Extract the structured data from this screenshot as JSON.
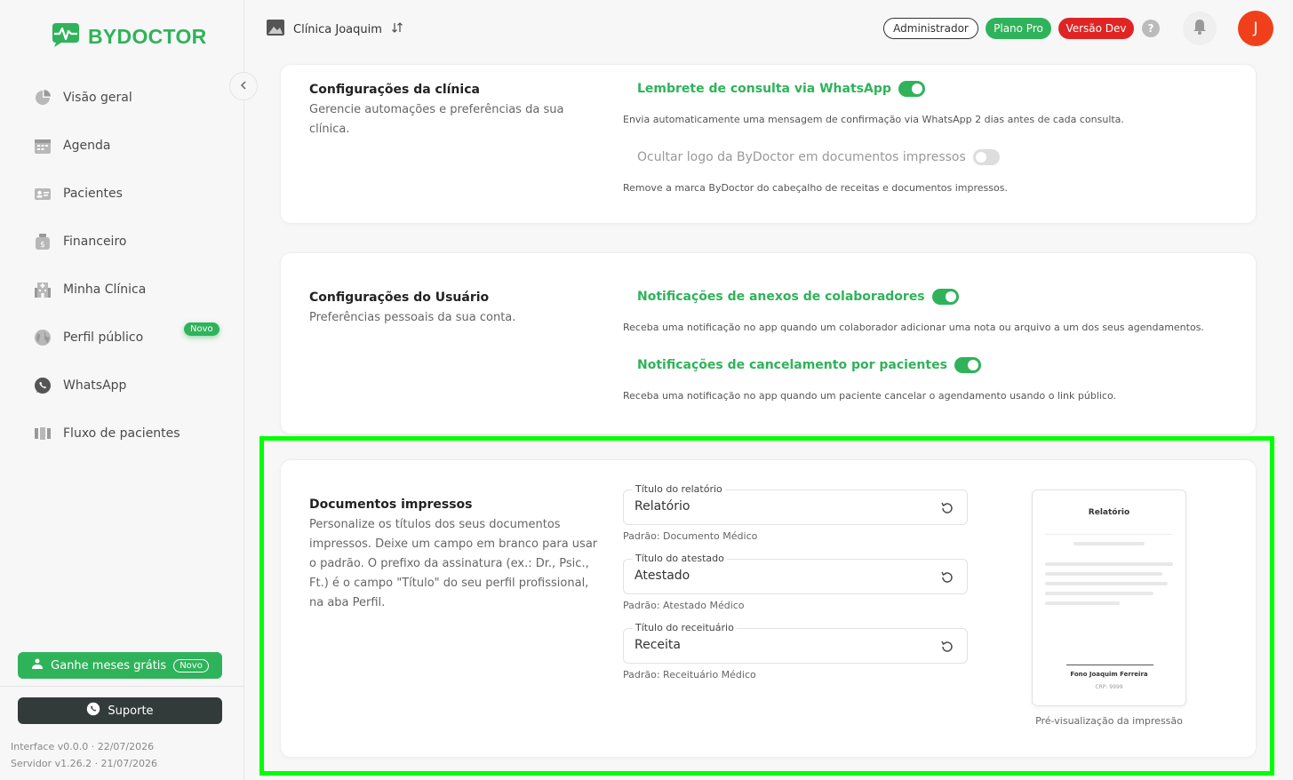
{
  "brand": {
    "name": "BYDOCTOR",
    "accent": "#2fb35a"
  },
  "sidebar": {
    "items": [
      {
        "label": "Visão geral",
        "icon": "pie-chart-icon"
      },
      {
        "label": "Agenda",
        "icon": "calendar-icon"
      },
      {
        "label": "Pacientes",
        "icon": "patient-card-icon"
      },
      {
        "label": "Financeiro",
        "icon": "money-bag-icon"
      },
      {
        "label": "Minha Clínica",
        "icon": "building-icon"
      },
      {
        "label": "Perfil público",
        "icon": "globe-icon",
        "badge": "Novo"
      },
      {
        "label": "WhatsApp",
        "icon": "whatsapp-icon"
      },
      {
        "label": "Fluxo de pacientes",
        "icon": "kanban-icon"
      }
    ],
    "promo": {
      "label": "Ganhe meses grátis",
      "badge": "Novo"
    },
    "support": {
      "label": "Suporte"
    },
    "version_interface": "Interface v0.0.0 · 22/07/2026",
    "version_server": "Servidor v1.26.2 · 21/07/2026"
  },
  "topbar": {
    "clinic": "Clínica Joaquim",
    "role": "Administrador",
    "plan": "Plano Pro",
    "version": "Versão Dev",
    "help": "?",
    "avatar_initial": "J"
  },
  "clinic_settings": {
    "title": "Configurações da clínica",
    "desc": "Gerencie automações e preferências da sua clínica.",
    "whatsapp_reminder": {
      "label": "Lembrete de consulta via WhatsApp",
      "enabled": true,
      "desc": "Envia automaticamente uma mensagem de confirmação via WhatsApp 2 dias antes de cada consulta."
    },
    "hide_logo": {
      "label": "Ocultar logo da ByDoctor em documentos impressos",
      "enabled": false,
      "desc": "Remove a marca ByDoctor do cabeçalho de receitas e documentos impressos."
    }
  },
  "user_settings": {
    "title": "Configurações do Usuário",
    "desc": "Preferências pessoais da sua conta.",
    "attachments_notif": {
      "label": "Notificações de anexos de colaboradores",
      "enabled": true,
      "desc": "Receba uma notificação no app quando um colaborador adicionar uma nota ou arquivo a um dos seus agendamentos."
    },
    "cancel_notif": {
      "label": "Notificações de cancelamento por pacientes",
      "enabled": true,
      "desc": "Receba uma notificação no app quando um paciente cancelar o agendamento usando o link público."
    }
  },
  "printed_docs": {
    "title": "Documentos impressos",
    "desc": "Personalize os títulos dos seus documentos impressos. Deixe um campo em branco para usar o padrão. O prefixo da assinatura (ex.: Dr., Psic., Ft.) é o campo \"Título\" do seu perfil profissional, na aba Perfil.",
    "report": {
      "label": "Título do relatório",
      "value": "Relatório",
      "hint": "Padrão: Documento Médico"
    },
    "certificate": {
      "label": "Título do atestado",
      "value": "Atestado",
      "hint": "Padrão: Atestado Médico"
    },
    "prescription": {
      "label": "Título do receituário",
      "value": "Receita",
      "hint": "Padrão: Receituário Médico"
    },
    "preview": {
      "title": "Relatório",
      "signer": "Fono Joaquim Ferreira",
      "crp": "CRP: 9999",
      "caption": "Pré-visualização da impressão"
    }
  }
}
